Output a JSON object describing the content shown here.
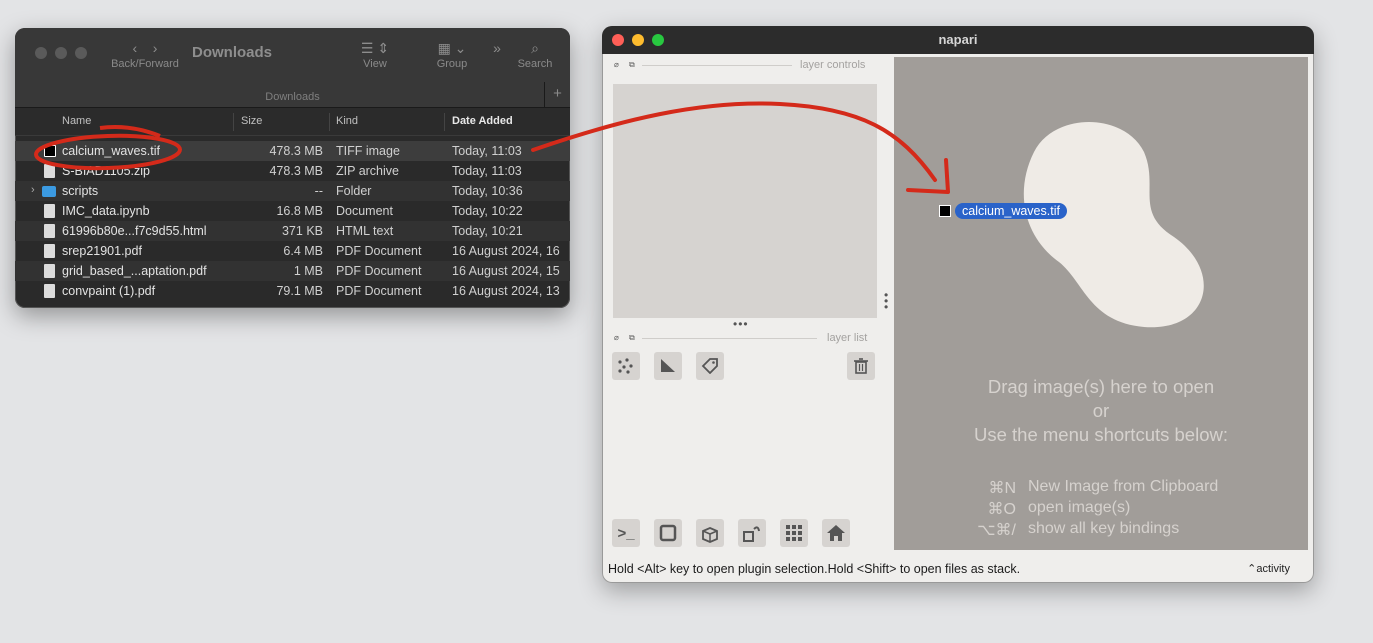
{
  "finder": {
    "title": "Downloads",
    "nav_label": "Back/Forward",
    "view_label": "View",
    "group_label": "Group",
    "search_label": "Search",
    "path": "Downloads",
    "add_label": "+",
    "columns": {
      "name": "Name",
      "size": "Size",
      "kind": "Kind",
      "date": "Date Added"
    },
    "rows": [
      {
        "name": "calcium_waves.tif",
        "size": "478.3 MB",
        "kind": "TIFF image",
        "date": "Today, 11:03",
        "icon": "black-square-icon"
      },
      {
        "name": "S-BIAD1105.zip",
        "size": "478.3 MB",
        "kind": "ZIP archive",
        "date": "Today, 11:03",
        "icon": "zip-file-icon"
      },
      {
        "name": "scripts",
        "size": "--",
        "kind": "Folder",
        "date": "Today, 10:36",
        "icon": "folder-icon"
      },
      {
        "name": "IMC_data.ipynb",
        "size": "16.8 MB",
        "kind": "Document",
        "date": "Today, 10:22",
        "icon": "document-icon"
      },
      {
        "name": "61996b80e...f7c9d55.html",
        "size": "371 KB",
        "kind": "HTML text",
        "date": "Today, 10:21",
        "icon": "document-icon"
      },
      {
        "name": "srep21901.pdf",
        "size": "6.4 MB",
        "kind": "PDF Document",
        "date": "16 August 2024, 16",
        "icon": "pdf-icon"
      },
      {
        "name": "grid_based_...aptation.pdf",
        "size": "1 MB",
        "kind": "PDF Document",
        "date": "16 August 2024, 15",
        "icon": "pdf-icon"
      },
      {
        "name": "convpaint (1).pdf",
        "size": "79.1 MB",
        "kind": "PDF Document",
        "date": "16 August 2024, 13",
        "icon": "pdf-icon"
      }
    ]
  },
  "napari": {
    "title": "napari",
    "layer_controls_label": "layer controls",
    "layer_list_label": "layer list",
    "drop_line1": "Drag image(s) here to open",
    "drop_line2": "or",
    "drop_line3": "Use the menu shortcuts below:",
    "shortcuts": [
      {
        "key": "⌘N",
        "desc": "New Image from Clipboard"
      },
      {
        "key": "⌘O",
        "desc": "open image(s)"
      },
      {
        "key": "⌥⌘/",
        "desc": "show all key bindings"
      }
    ],
    "status": "Hold <Alt> key to open plugin selection.Hold <Shift> to open files as stack.",
    "activity": "activity"
  },
  "drag_file": {
    "name": "calcium_waves.tif"
  },
  "colors": {
    "annotation": "#d42a1a",
    "selection": "#2a63c9"
  }
}
